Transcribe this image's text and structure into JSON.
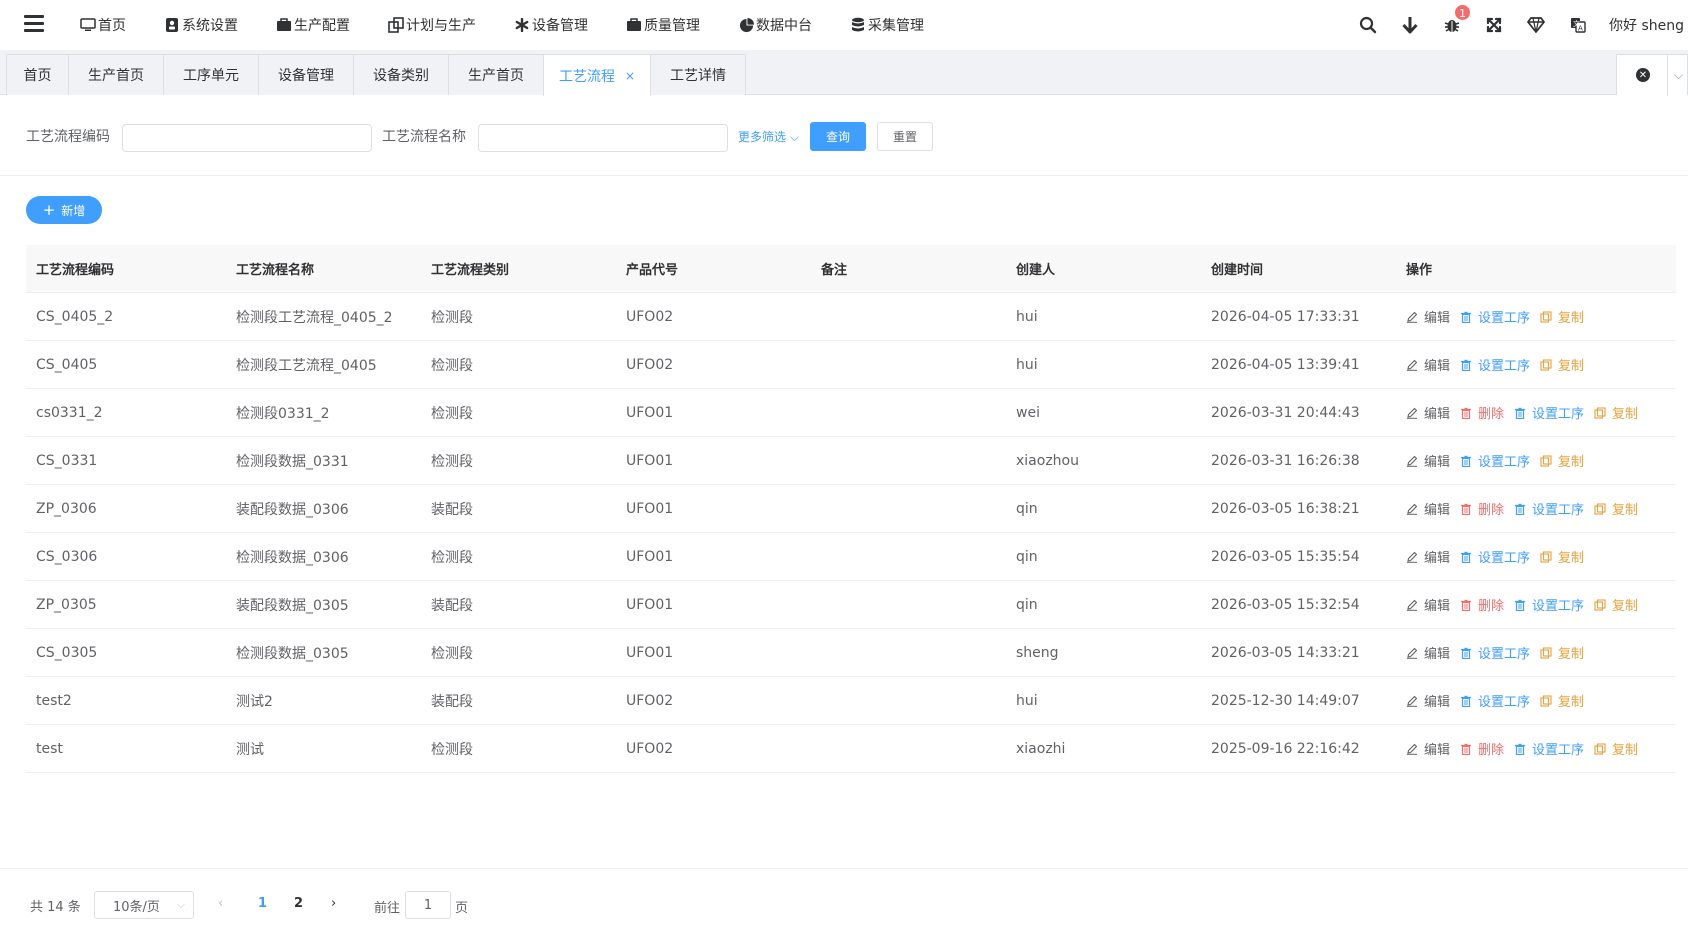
{
  "topnav": {
    "menu": [
      {
        "label": "首页",
        "icon": "monitor-icon"
      },
      {
        "label": "系统设置",
        "icon": "user-lock-icon"
      },
      {
        "label": "生产配置",
        "icon": "briefcase-icon"
      },
      {
        "label": "计划与生产",
        "icon": "copy-icon"
      },
      {
        "label": "设备管理",
        "icon": "asterisk-icon"
      },
      {
        "label": "质量管理",
        "icon": "briefcase-icon"
      },
      {
        "label": "数据中台",
        "icon": "pie-chart-icon"
      },
      {
        "label": "采集管理",
        "icon": "database-icon"
      }
    ],
    "notification_count": "1",
    "greeting": "你好 sheng"
  },
  "tabs": [
    {
      "label": "首页",
      "active": false
    },
    {
      "label": "生产首页",
      "active": false
    },
    {
      "label": "工序单元",
      "active": false
    },
    {
      "label": "设备管理",
      "active": false
    },
    {
      "label": "设备类别",
      "active": false
    },
    {
      "label": "生产首页",
      "active": false
    },
    {
      "label": "工艺流程",
      "active": true,
      "close": "×"
    },
    {
      "label": "工艺详情",
      "active": false
    }
  ],
  "filter": {
    "code_label": "工艺流程编码",
    "code_value": "",
    "name_label": "工艺流程名称",
    "name_value": "",
    "more_label": "更多筛选",
    "query_label": "查询",
    "reset_label": "重置"
  },
  "add_label": "新增",
  "table": {
    "headers": [
      "工艺流程编码",
      "工艺流程名称",
      "工艺流程类别",
      "产品代号",
      "备注",
      "创建人",
      "创建时间",
      "操作"
    ],
    "rows": [
      {
        "code": "CS_0405_2",
        "name": "检测段工艺流程_0405_2",
        "type": "检测段",
        "product": "UFO02",
        "remark": "",
        "creator": "hui",
        "time": "2026-04-05 17:33:31",
        "deletable": false
      },
      {
        "code": "CS_0405",
        "name": "检测段工艺流程_0405",
        "type": "检测段",
        "product": "UFO02",
        "remark": "",
        "creator": "hui",
        "time": "2026-04-05 13:39:41",
        "deletable": false
      },
      {
        "code": "cs0331_2",
        "name": "检测段0331_2",
        "type": "检测段",
        "product": "UFO01",
        "remark": "",
        "creator": "wei",
        "time": "2026-03-31 20:44:43",
        "deletable": true
      },
      {
        "code": "CS_0331",
        "name": "检测段数据_0331",
        "type": "检测段",
        "product": "UFO01",
        "remark": "",
        "creator": "xiaozhou",
        "time": "2026-03-31 16:26:38",
        "deletable": false
      },
      {
        "code": "ZP_0306",
        "name": "装配段数据_0306",
        "type": "装配段",
        "product": "UFO01",
        "remark": "",
        "creator": "qin",
        "time": "2026-03-05 16:38:21",
        "deletable": true
      },
      {
        "code": "CS_0306",
        "name": "检测段数据_0306",
        "type": "检测段",
        "product": "UFO01",
        "remark": "",
        "creator": "qin",
        "time": "2026-03-05 15:35:54",
        "deletable": false
      },
      {
        "code": "ZP_0305",
        "name": "装配段数据_0305",
        "type": "装配段",
        "product": "UFO01",
        "remark": "",
        "creator": "qin",
        "time": "2026-03-05 15:32:54",
        "deletable": true
      },
      {
        "code": "CS_0305",
        "name": "检测段数据_0305",
        "type": "检测段",
        "product": "UFO01",
        "remark": "",
        "creator": "sheng",
        "time": "2026-03-05 14:33:21",
        "deletable": false
      },
      {
        "code": "test2",
        "name": "测试2",
        "type": "装配段",
        "product": "UFO02",
        "remark": "",
        "creator": "hui",
        "time": "2025-12-30 14:49:07",
        "deletable": false
      },
      {
        "code": "test",
        "name": "测试",
        "type": "检测段",
        "product": "UFO02",
        "remark": "",
        "creator": "xiaozhi",
        "time": "2025-09-16 22:16:42",
        "deletable": true
      }
    ],
    "ops": {
      "edit": "编辑",
      "delete": "删除",
      "set_process": "设置工序",
      "copy": "复制"
    }
  },
  "pagination": {
    "total": "共 14 条",
    "page_size": "10条/页",
    "pages": [
      "1",
      "2"
    ],
    "current_page": "1",
    "goto_label": "前往",
    "goto_value": "1",
    "page_suffix": "页"
  },
  "colors": {
    "primary": "#409eff",
    "danger": "#f56c6c",
    "warning": "#e6a23c"
  }
}
